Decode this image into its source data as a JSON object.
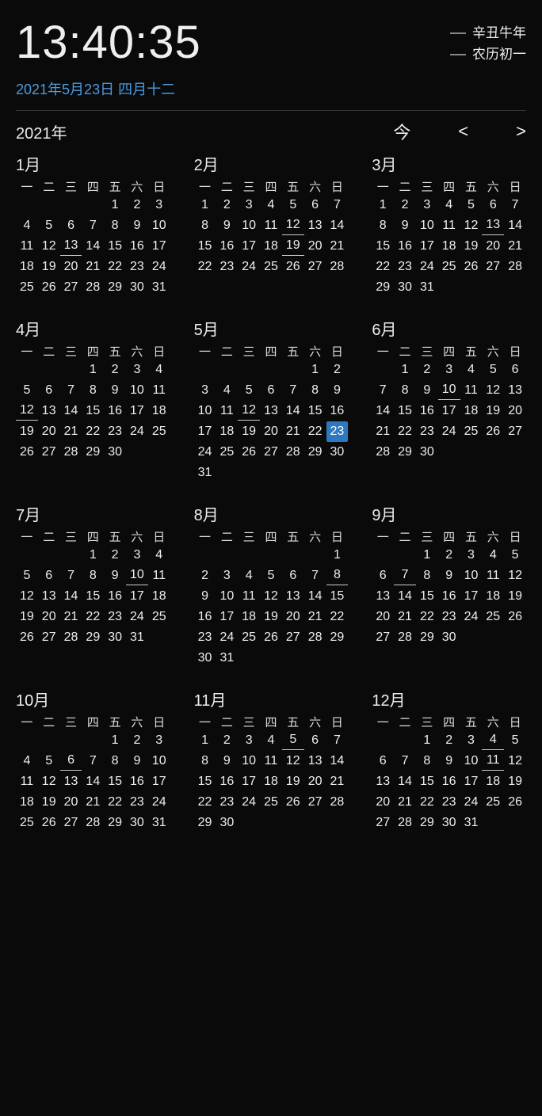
{
  "header": {
    "time": "13:40:35",
    "lunar_year": "辛丑牛年",
    "lunar_day": "农历初一",
    "date_line": "2021年5月23日 四月十二"
  },
  "toolbar": {
    "year_label": "2021年",
    "today_label": "今",
    "prev_label": "<",
    "next_label": ">"
  },
  "dow": [
    "一",
    "二",
    "三",
    "四",
    "五",
    "六",
    "日"
  ],
  "months": [
    {
      "title": "1月",
      "start": 4,
      "days": 31,
      "underline": [
        13
      ]
    },
    {
      "title": "2月",
      "start": 0,
      "days": 28,
      "underline": [
        12,
        19
      ]
    },
    {
      "title": "3月",
      "start": 0,
      "days": 31,
      "underline": [
        13
      ]
    },
    {
      "title": "4月",
      "start": 3,
      "days": 30,
      "underline": [
        12
      ]
    },
    {
      "title": "5月",
      "start": 5,
      "days": 31,
      "underline": [
        12
      ],
      "highlight": 23
    },
    {
      "title": "6月",
      "start": 1,
      "days": 30,
      "underline": [
        10
      ]
    },
    {
      "title": "7月",
      "start": 3,
      "days": 31,
      "underline": [
        10
      ]
    },
    {
      "title": "8月",
      "start": 6,
      "days": 31,
      "underline": [
        8
      ]
    },
    {
      "title": "9月",
      "start": 2,
      "days": 30,
      "underline": [
        7
      ]
    },
    {
      "title": "10月",
      "start": 4,
      "days": 31,
      "underline": [
        6
      ]
    },
    {
      "title": "11月",
      "start": 0,
      "days": 30,
      "underline": [
        5
      ]
    },
    {
      "title": "12月",
      "start": 2,
      "days": 31,
      "underline": [
        4,
        11
      ]
    }
  ]
}
